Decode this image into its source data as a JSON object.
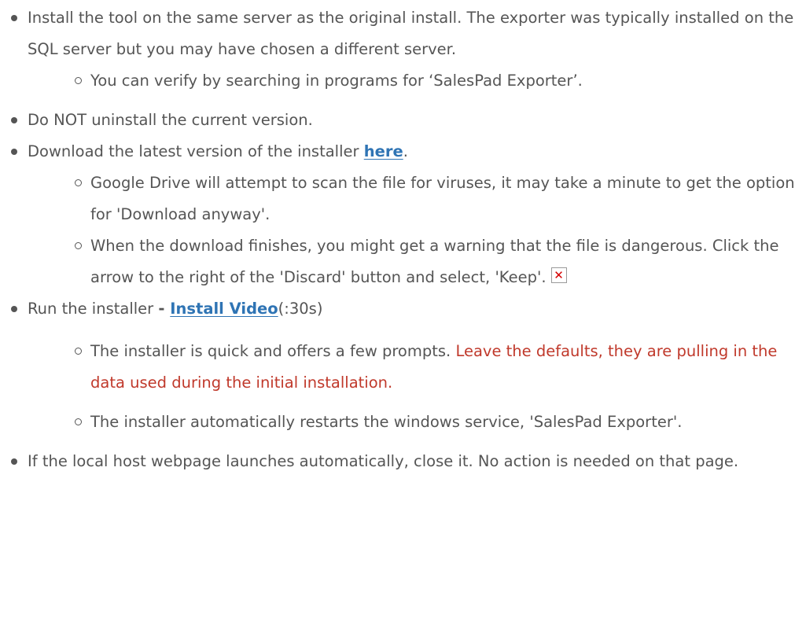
{
  "items": {
    "install_tool": "Install the tool on the same server as the original install. The exporter was typically installed on the SQL server but you may have chosen a different server.",
    "verify": "You can verify by searching in programs for ‘SalesPad Exporter’.",
    "do_not_uninstall": "Do NOT uninstall the current version.",
    "download_prefix": "Download the latest version of the installer ",
    "download_link": "here",
    "download_suffix": ".",
    "google_drive": "Google Drive will attempt to scan the file for viruses, it may take a minute to get the option for 'Download anyway'.",
    "warning": "When the download finishes, you might get a warning that the file is dangerous. Click the arrow to the right of the 'Discard' button and select, 'Keep'.",
    "run_prefix": "Run the installer ",
    "run_dash": "- ",
    "run_link": "Install Video",
    "run_suffix": "(:30s)",
    "quick_prefix": "The installer is quick and offers a few prompts. ",
    "quick_red": "Leave the defaults, they are pulling in the data used during the initial installation.",
    "restart": "The installer automatically restarts the windows service, 'SalesPad Exporter'.",
    "localhost": "If the local host webpage launches automatically, close it. No action is needed on that page."
  },
  "icons": {
    "broken_image": "broken-image-icon"
  },
  "colors": {
    "text": "#555555",
    "link": "#2f74b4",
    "emphasis": "#c0392b"
  }
}
